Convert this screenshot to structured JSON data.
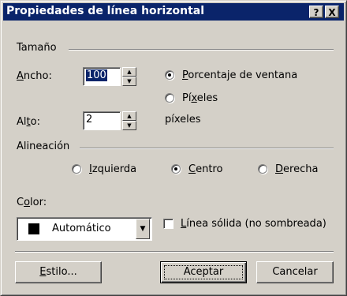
{
  "window": {
    "title": "Propiedades de línea horizontal",
    "help_label": "?",
    "close_label": "X"
  },
  "size_group": {
    "label": "Tamaño",
    "width_label_pre": "",
    "width_label_ul": "A",
    "width_label_post": "ncho:",
    "width_value": "100",
    "height_label_pre": "Al",
    "height_label_ul": "t",
    "height_label_post": "o:",
    "height_value": "2",
    "height_unit": "píxeles",
    "radio_percent_pre": "",
    "radio_percent_ul": "P",
    "radio_percent_post": "orcentaje de ventana",
    "radio_pixels_pre": "Pí",
    "radio_pixels_ul": "x",
    "radio_pixels_post": "eles"
  },
  "align_group": {
    "label": "Alineación",
    "left_ul": "I",
    "left_post": "zquierda",
    "center_ul": "C",
    "center_post": "entro",
    "right_ul": "D",
    "right_post": "erecha"
  },
  "color": {
    "label_ul": "o",
    "label_pre": "C",
    "label_post": "lor:",
    "value": "Automático",
    "swatch": "#000000"
  },
  "solid_line": {
    "label_ul": "L",
    "label_post": "ínea sólida (no sombreada)"
  },
  "buttons": {
    "style_ul": "E",
    "style_post": "stilo...",
    "accept": "Aceptar",
    "cancel": "Cancelar"
  },
  "colors": {
    "titlebar": "#0a246a",
    "face": "#d4d0c8"
  }
}
